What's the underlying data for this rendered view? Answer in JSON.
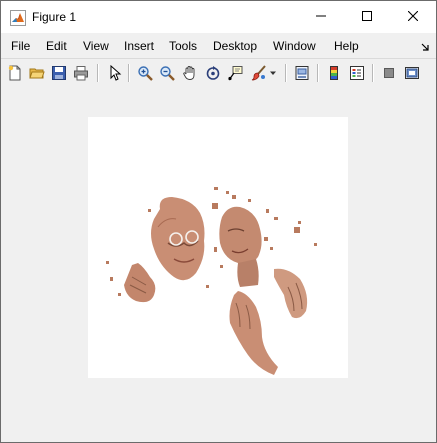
{
  "window": {
    "title": "Figure 1",
    "app_icon": "matlab-icon",
    "controls": [
      "minimize-icon",
      "maximize-icon",
      "close-icon"
    ]
  },
  "menu": {
    "items": [
      "File",
      "Edit",
      "View",
      "Insert",
      "Tools",
      "Desktop",
      "Window",
      "Help"
    ]
  },
  "toolbar": {
    "buttons": [
      "new-figure-icon",
      "open-file-icon",
      "save-icon",
      "print-icon",
      "edit-plot-arrow-icon",
      "zoom-in-icon",
      "zoom-out-icon",
      "pan-hand-icon",
      "rotate-3d-icon",
      "data-cursor-icon",
      "brush-icon",
      "brush-dropdown-icon",
      "link-plot-icon",
      "insert-colorbar-icon",
      "insert-legend-icon",
      "hide-plot-tools-icon",
      "show-plot-tools-icon"
    ]
  },
  "figure": {
    "content": "segmented-skin-image",
    "colors": {
      "skin": "#c98e74",
      "skin_dark": "#8a5a45",
      "background": "#ffffff"
    }
  }
}
